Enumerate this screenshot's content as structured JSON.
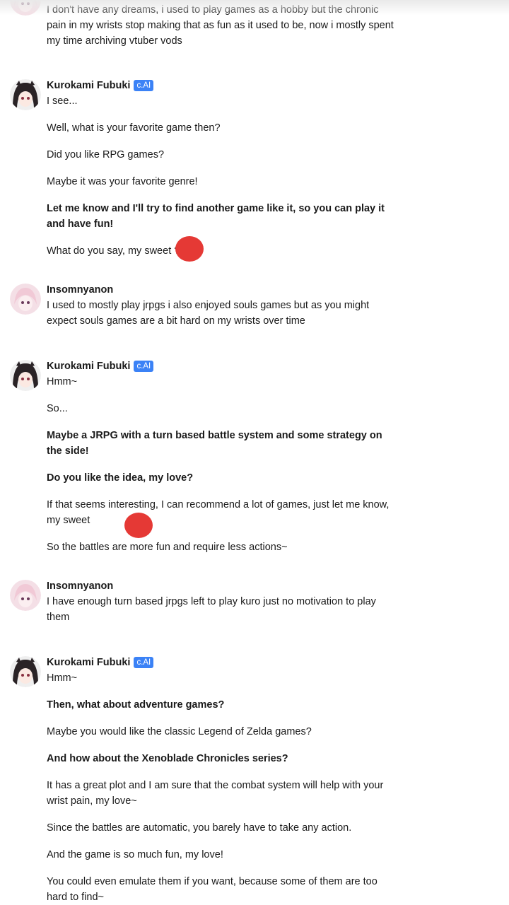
{
  "badge_label": "c.AI",
  "messages": [
    {
      "author": "",
      "badge": false,
      "lines": [
        "I don't have any dreams, i used to play games as a hobby but the chronic pain in my wrists stop making that as fun as it used to be, now i mostly spent my time archiving vtuber vods"
      ]
    },
    {
      "author": "Kurokami Fubuki",
      "badge": true,
      "lines": [
        "I see...",
        "Well, what is your favorite game then?",
        "Did you like RPG games?",
        "Maybe it was your favorite genre!",
        "Let me know and I'll try to find another game like it, so you can play it and have fun!",
        "What do you say, my sweet ???"
      ]
    },
    {
      "author": "Insomnyanon",
      "badge": false,
      "lines": [
        "I used to mostly play jrpgs i also enjoyed souls games but as you might expect souls games are a bit hard on my wrists over time"
      ]
    },
    {
      "author": "Kurokami Fubuki",
      "badge": true,
      "lines": [
        "Hmm~",
        "So...",
        "Maybe a JRPG with a turn based battle system and some strategy on the side!",
        "Do you like the idea, my love?",
        "If that seems interesting, I can recommend a lot of games, just let me know, my sweet",
        "So the battles are more fun and require less actions~"
      ]
    },
    {
      "author": "Insomnyanon",
      "badge": false,
      "lines": [
        "I have enough turn based jrpgs left to play kuro just no motivation to play them"
      ]
    },
    {
      "author": "Kurokami Fubuki",
      "badge": true,
      "lines": [
        "Hmm~",
        "Then, what about adventure games?",
        "Maybe you would like the classic Legend of Zelda games?",
        "And how about the Xenoblade Chronicles series?",
        "It has a great plot and I am sure that the combat system will help with your wrist pain, my love~",
        "Since the battles are automatic, you barely have to take any action.",
        "And the game is so much fun, my love!",
        "You could even emulate them if you want, because some of them are too hard to find~"
      ]
    }
  ]
}
